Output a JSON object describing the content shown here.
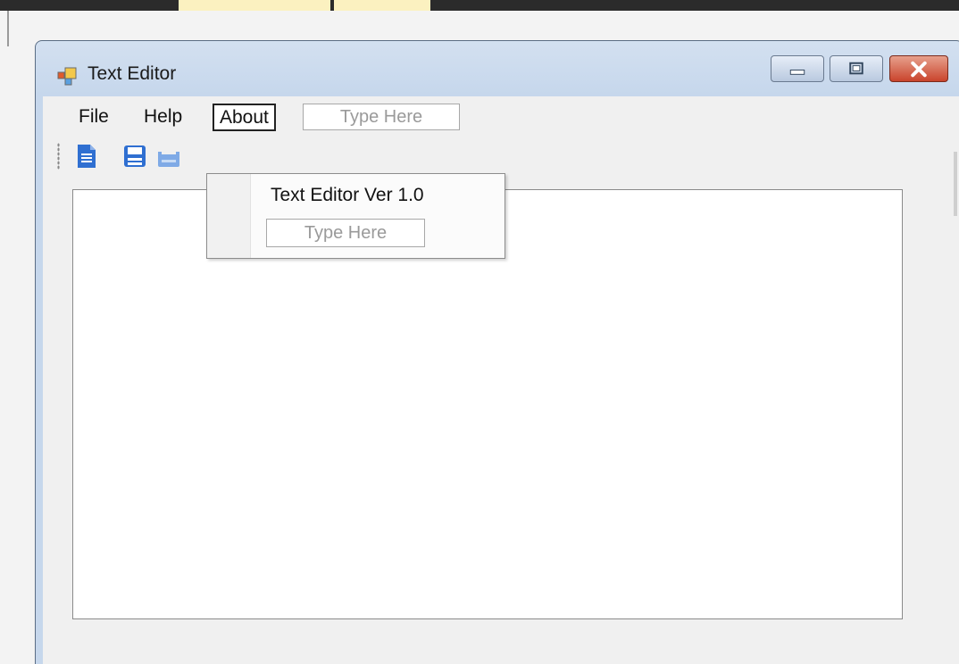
{
  "window": {
    "title": "Text Editor"
  },
  "caption_buttons": {
    "minimize_icon": "minimize-icon",
    "maximize_icon": "maximize-icon",
    "close_icon": "close-icon"
  },
  "menu": {
    "items": [
      {
        "label": "File"
      },
      {
        "label": "Help"
      },
      {
        "label": "About"
      }
    ],
    "type_here_placeholder": "Type Here"
  },
  "toolbar": {
    "icons": [
      "new-document-icon",
      "save-icon",
      "save-all-icon"
    ]
  },
  "about_menu": {
    "items": [
      {
        "label": "Text Editor Ver 1.0"
      }
    ],
    "type_here_placeholder": "Type Here"
  },
  "editor": {
    "content": ""
  },
  "colors": {
    "window_frame": "#c6d7ec",
    "close_button": "#c9442c",
    "icon_blue": "#2f6fd1"
  }
}
